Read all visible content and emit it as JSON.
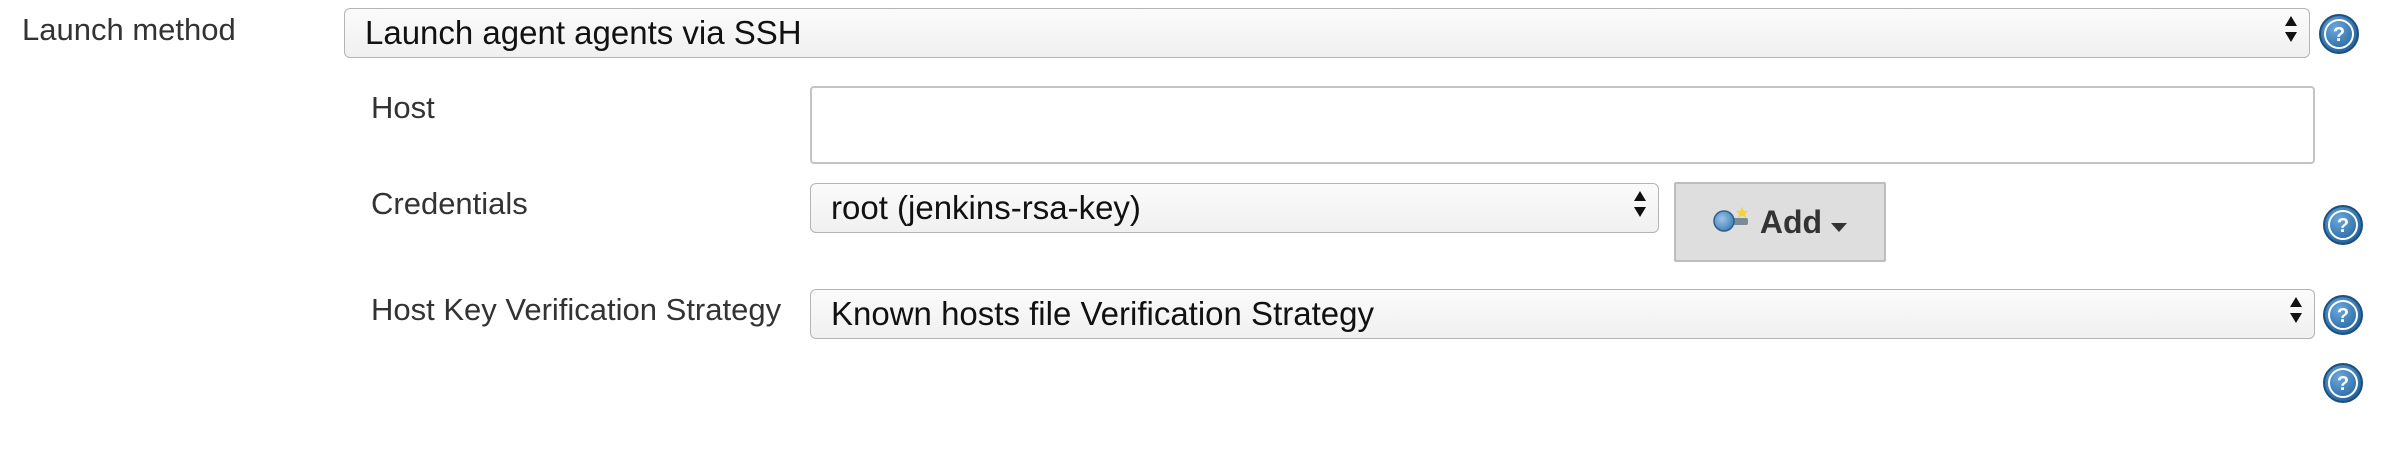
{
  "launch_method": {
    "label": "Launch method",
    "selected": "Launch agent agents via SSH"
  },
  "host": {
    "label": "Host",
    "value": "",
    "placeholder": ""
  },
  "credentials": {
    "label": "Credentials",
    "selected": "root (jenkins-rsa-key)",
    "add_label": "Add"
  },
  "host_key": {
    "label": "Host Key Verification Strategy",
    "selected": "Known hosts file Verification Strategy"
  },
  "colors": {
    "help_icon": "#2a6fa8",
    "add_button_bg": "#dedede",
    "label_text": "#333333"
  },
  "icons": [
    "help-icon",
    "select-arrows-icon",
    "key-icon",
    "caret-down-icon"
  ]
}
